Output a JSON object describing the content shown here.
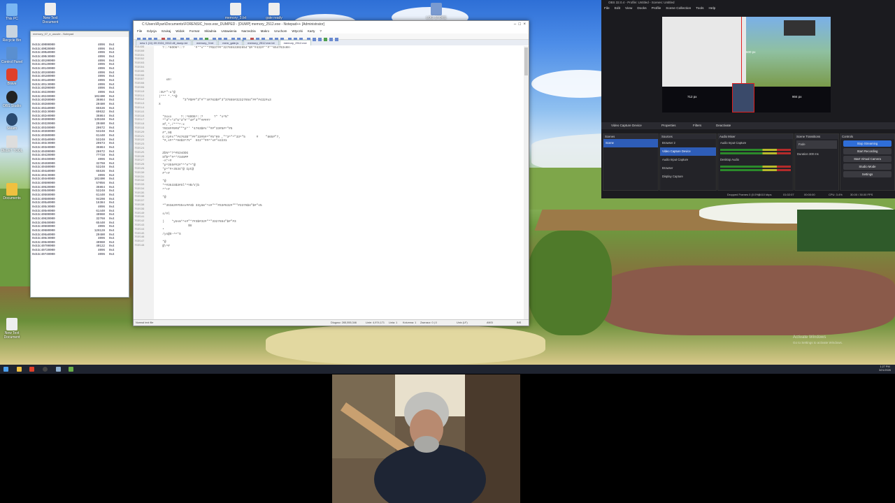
{
  "desktop": {
    "icons": [
      {
        "label": "New Text Document"
      },
      {
        "label": "memory_3.txt"
      },
      {
        "label": "gate ready"
      },
      {
        "label": "LOG STORE"
      }
    ],
    "left_icons": [
      "This PC",
      "Recycle Bin",
      "Control Panel",
      "Brave",
      "OBS Studio",
      "Steam",
      "DELET TOOL",
      "Documents",
      "New Text Document"
    ],
    "watermark": {
      "line1": "Activate Windows",
      "line2": "Go to Settings to activate Windows."
    }
  },
  "hex_window": {
    "title": "memory_07_e_uscute - Notepad",
    "rows": [
      [
        "0x53c40000000",
        "4096",
        "0x4"
      ],
      [
        "0x53c40020000",
        "4096",
        "0x4"
      ],
      [
        "0x53c400a0000",
        "4096",
        "0x4"
      ],
      [
        "0x53c400c0000",
        "4096",
        "0x4"
      ],
      [
        "0x53c40100000",
        "4096",
        "0x4"
      ],
      [
        "0x53c40120000",
        "4096",
        "0x4"
      ],
      [
        "0x53c40140000",
        "4096",
        "0x4"
      ],
      [
        "0x53c40160000",
        "4096",
        "0x4"
      ],
      [
        "0x53c40180000",
        "4096",
        "0x4"
      ],
      [
        "0x53c401a0000",
        "4096",
        "0x4"
      ],
      [
        "0x53c401c0000",
        "4096",
        "0x4"
      ],
      [
        "0x53c40200000",
        "4096",
        "0x4"
      ],
      [
        "0x53c40220000",
        "4096",
        "0x4"
      ],
      [
        "0x53c40240000",
        "102400",
        "0x4"
      ],
      [
        "0x53c40260000",
        "36864",
        "0x4"
      ],
      [
        "0x53c40280000",
        "20480",
        "0x4"
      ],
      [
        "0x53c402a0000",
        "65536",
        "0x4"
      ],
      [
        "0x53c402c0000",
        "69632",
        "0x4"
      ],
      [
        "0x53c402e0000",
        "36864",
        "0x4"
      ],
      [
        "0x53c40300000",
        "135168",
        "0x4"
      ],
      [
        "0x53c40320000",
        "20480",
        "0x4"
      ],
      [
        "0x53c40340000",
        "20672",
        "0x4"
      ],
      [
        "0x53c40360000",
        "53248",
        "0x4"
      ],
      [
        "0x53c40380000",
        "61440",
        "0x4"
      ],
      [
        "0x53c403a0000",
        "53248",
        "0x4"
      ],
      [
        "0x53c403c0000",
        "20673",
        "0x4"
      ],
      [
        "0x53c403e0000",
        "36864",
        "0x4"
      ],
      [
        "0x53c40400000",
        "28672",
        "0x4"
      ],
      [
        "0x53c40420000",
        "77728",
        "0x4"
      ],
      [
        "0x53c40440000",
        "4096",
        "0x4"
      ],
      [
        "0x53c40460000",
        "32768",
        "0x4"
      ],
      [
        "0x53c40480000",
        "53248",
        "0x4"
      ],
      [
        "0x53c404a0000",
        "65536",
        "0x4"
      ],
      [
        "0x53c404c0000",
        "4096",
        "0x4"
      ],
      [
        "0x53c404e0000",
        "102400",
        "0x4"
      ],
      [
        "0x53c40500000",
        "57056",
        "0x4"
      ],
      [
        "0x53c40520000",
        "36864",
        "0x4"
      ],
      [
        "0x53c40540000",
        "53248",
        "0x4"
      ],
      [
        "0x53c40560000",
        "61440",
        "0x4"
      ],
      [
        "0x53c40580000",
        "94208",
        "0x4"
      ],
      [
        "0x53c405a0000",
        "16384",
        "0x4"
      ],
      [
        "0x53c405c0000",
        "4096",
        "0x4"
      ],
      [
        "0x53c405e0000",
        "61440",
        "0x4"
      ],
      [
        "0x53c40600000",
        "40960",
        "0x4"
      ],
      [
        "0x53c40620000",
        "32768",
        "0x4"
      ],
      [
        "0x53c40640000",
        "65440",
        "0x4"
      ],
      [
        "0x53c40660000",
        "4096",
        "0x4"
      ],
      [
        "0x53c40680000",
        "126128",
        "0x4"
      ],
      [
        "0x53c406a0000",
        "20480",
        "0x4"
      ],
      [
        "0x53c406c0000",
        "4096",
        "0x4"
      ],
      [
        "0x53c406e0000",
        "40960",
        "0x4"
      ],
      [
        "0x53c40700000",
        "40122",
        "0x4"
      ],
      [
        "0x53c40720000",
        "4096",
        "0x4"
      ],
      [
        "0x53c40740000",
        "4096",
        "0x4"
      ]
    ]
  },
  "notepad": {
    "title": "C:\\Users\\Ryan\\Documents\\FORENSIC_hxxx.exe_DUMPED - [DUMP] memory_2512.exe - Notepad++ [Administrator]",
    "menu": [
      "File",
      "Edycja",
      "Szukaj",
      "Widok",
      "Format",
      "Skladnia",
      "Ustawienia",
      "Narzedzia",
      "Makro",
      "Uruchom",
      "Wtyczki",
      "Karty",
      "?"
    ],
    "tabs": [
      "new 1 (11) 09 2024_0012.dll_dump.txt",
      "memory_3.txt",
      "mem_gate.js",
      "memory_2512.exe.txt",
      "memory_2512.exe"
    ],
    "line_start": 755499,
    "text_lines": [
      "  ?::^6OO6^::?     '#\"*s*\"*7#$37##\"3276553302654\"$#\"#432#\"\"#\"*654763sHH-",
      "",
      "",
      "",
      "",
      "",
      "",
      "",
      "    x0!",
      "",
      "",
      ":XU^\"-u*@",
      ")*** *.*^@",
      "             \"3\"#$##\"3\"#\"*4#763$#\"3\"37655#32327654\"##\"#432#u3",
      "X",
      "",
      "",
      "  *Xxxx     ?::^6OO6^::?      ?* *x^%*",
      "  *\"3\"+*3\"5*3\"#'\"4#\"3\"\"####?",
      "  Xf,*,/***^:x",
      "  ?9I8##9#8\"\"*p*' *4763$#s'\"##\"33#5#^\"#5",
      "  #*,9$",
      "  G:rp#s*\"#4763$*\"##\"33#5#^\"#5*09 ,\"*3^\"^\"33^\"5      #    \"865#\"7,",
      "  *#,s#^*^94$3^7V*  GI2*\"##^*s#\"e2231",
      "",
      "",
      "  Zb%^*7^#53sDDG",
      "  Sf$^\"#^*7345PP",
      "  -A*+#",
      "  *p^355##2#*^*e*^*@",
      "  *p^*#+3534*@ Ipt@",
      "  #*+#",
      "",
      "  *@",
      "  *^#3533$3#Sl*^YB/V)b",
      "  ^*+#",
      "",
      "  *@",
      "",
      "  *\"3S3&3##S5sv##4$ 33yUm*^s#\"*\"#S3#632#\"\"\"#3376$4\"$#\"s%",
      "",
      "  s/#l",
      "",
      "  )    *yUsm*^s#\"*7#3$#32#\"*\"3327654\"$#\"#3",
      "                $U",
      "  *",
      "  /ys@O-^^*S",
      "",
      "  *@",
      "  @\\^#"
    ],
    "status": {
      "type": "Normal text file",
      "length": "Dlugosc: 265,555,346",
      "lines": "Linie: 4,974,171",
      "line": "Linia: 1",
      "column": "Kolumna: 1",
      "sel": "Zaznacz: 0 | 0",
      "eol": "Unix (LF)",
      "enc": "ANSI",
      "mode": "INS"
    }
  },
  "obs": {
    "title": "OBS 32.0.4 - Profile: Untitled - Scenes: Untitled",
    "menu": [
      "File",
      "Edit",
      "View",
      "Docks",
      "Profile",
      "Scene Collection",
      "Tools",
      "Help"
    ],
    "preview_labels": {
      "left": "712 px",
      "right": "904 px",
      "top": "600 px"
    },
    "source_bar": {
      "source": "Video Capture Device",
      "properties": "Properties",
      "filters": "Filters",
      "deactivate": "Deactivate"
    },
    "scenes_title": "Scenes",
    "scenes": [
      "Scene"
    ],
    "sources_title": "Sources",
    "sources": [
      "Browser 2",
      "Video Capture Device",
      "Audio Input Capture",
      "Browser",
      "Display Capture"
    ],
    "mixer_title": "Audio Mixer",
    "mixer": [
      {
        "name": "Audio Input Capture",
        "db": "0.0 dB"
      },
      {
        "name": "Desktop Audio",
        "db": "0.0 dB"
      }
    ],
    "transitions_title": "Scene Transitions",
    "transition": "Fade",
    "duration_label": "Duration",
    "duration": "300 ms",
    "controls_title": "Controls",
    "controls": [
      "Stop Streaming",
      "Start Recording",
      "Start Virtual Camera",
      "Studio Mode",
      "Settings"
    ],
    "status": {
      "dropped": "Dropped Frames 0 (0.0%)",
      "kbps": "8410 kbps",
      "live": "01:02:07",
      "rec": "00:00:00",
      "cpu": "CPU: 3.4%",
      "fps": "30.00 / 30.00 FPS"
    }
  },
  "taskbar": {
    "time": "1:27 PM",
    "date": "3/21/2026"
  }
}
